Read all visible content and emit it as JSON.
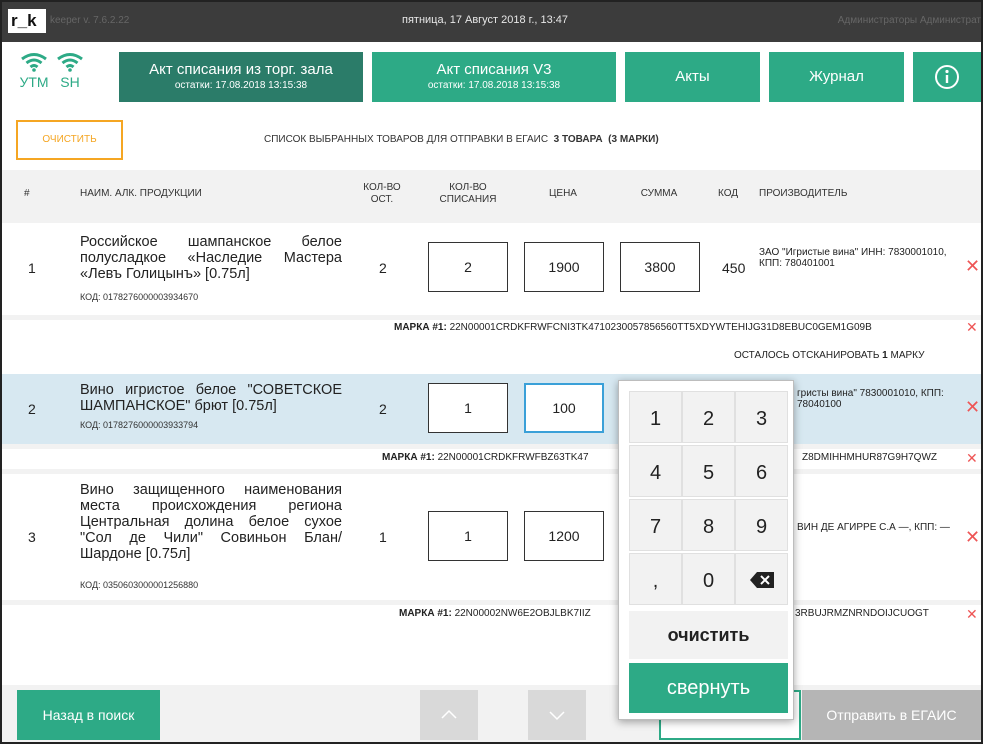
{
  "topbar": {
    "logo": "r_k",
    "version": "keeper v. 7.6.2.22",
    "datetime": "пятница, 17 Август 2018 г., 13:47",
    "user": "Администраторы Администрат"
  },
  "status": {
    "utm": "УТМ",
    "sh": "SH"
  },
  "header": {
    "tab1_title": "Акт списания из торг. зала",
    "tab1_sub": "остатки: 17.08.2018 13:15:38",
    "tab2_title": "Акт списания V3",
    "tab2_sub": "остатки: 17.08.2018 13:15:38",
    "acts": "Акты",
    "journal": "Журнал",
    "info_icon": "info-icon"
  },
  "toolbar": {
    "clear": "ОЧИСТИТЬ",
    "summary_text": "СПИСОК ВЫБРАННЫХ ТОВАРОВ ДЛЯ ОТПРАВКИ В ЕГАИС",
    "summary_count": "3 ТОВАРА",
    "summary_marks": "(3 МАРКИ)"
  },
  "columns": {
    "num": "#",
    "name": "НАИМ. АЛК. ПРОДУКЦИИ",
    "ost": "КОЛ-ВО ОСТ.",
    "spis": "КОЛ-ВО СПИСАНИЯ",
    "price": "ЦЕНА",
    "sum": "СУММА",
    "code": "КОД",
    "producer": "ПРОИЗВОДИТЕЛЬ"
  },
  "rows": [
    {
      "num": "1",
      "name": "Российское шампанское белое полусладкое «Наследие Мастера «Левъ Голицынъ» [0.75л]",
      "code": "КОД: 0178276000003934670",
      "ost": "2",
      "qty": "2",
      "price": "1900",
      "sum": "3800",
      "kod": "450",
      "producer": "ЗАО \"Игристые вина\" ИНН: 7830001010, КПП: 780401001",
      "marka_label": "МАРКА #1:",
      "marka": "22N00001CRDKFRWFCNI3TK4710230057856560TT5XDYWTEHIJG31D8EBUC0GEM1G09B",
      "remain_text": "ОСТАЛОСЬ ОТСКАНИРОВАТЬ",
      "remain_count": "1",
      "remain_unit": "МАРКУ"
    },
    {
      "num": "2",
      "name": "Вино игристое белое \"СОВЕТСКОЕ ШАМПАНСКОЕ\" брют [0.75л]",
      "code": "КОД: 0178276000003933794",
      "ost": "2",
      "qty": "1",
      "price": "100",
      "producer": "гристы вина\" 7830001010, КПП: 78040100",
      "marka_label": "МАРКА #1:",
      "marka": "22N00001CRDKFRWFBZ63TK47",
      "marka_tail": "Z8DMIHHMHUR87G9H7QWZ"
    },
    {
      "num": "3",
      "name": "Вино защищенного наименования места происхождения региона Центральная долина белое сухое \"Сол де Чили\" Совиньон Блан/ Шардоне [0.75л]",
      "code": "КОД: 0350603000001256880",
      "ost": "1",
      "qty": "1",
      "price": "1200",
      "producer": "ВИН ДЕ АГИРРЕ С.А —, КПП: —",
      "marka_label": "МАРКА #1:",
      "marka": "22N00002NW6E2OBJLBK7IIZ",
      "marka_tail": "3RBUJRMZNRNDOIJCUOGT"
    }
  ],
  "keypad": {
    "keys": [
      "1",
      "2",
      "3",
      "4",
      "5",
      "6",
      "7",
      "8",
      "9",
      ",",
      "0"
    ],
    "clear": "очистить",
    "fold": "свернуть"
  },
  "bottom": {
    "back": "Назад в поиск",
    "send": "Отправить в ЕГАИС"
  },
  "colors": {
    "accent": "#2daa86",
    "accent_dark": "#2b7c69",
    "orange": "#f5a623",
    "selected_row": "#d7e8f1",
    "delete": "#e55555"
  }
}
